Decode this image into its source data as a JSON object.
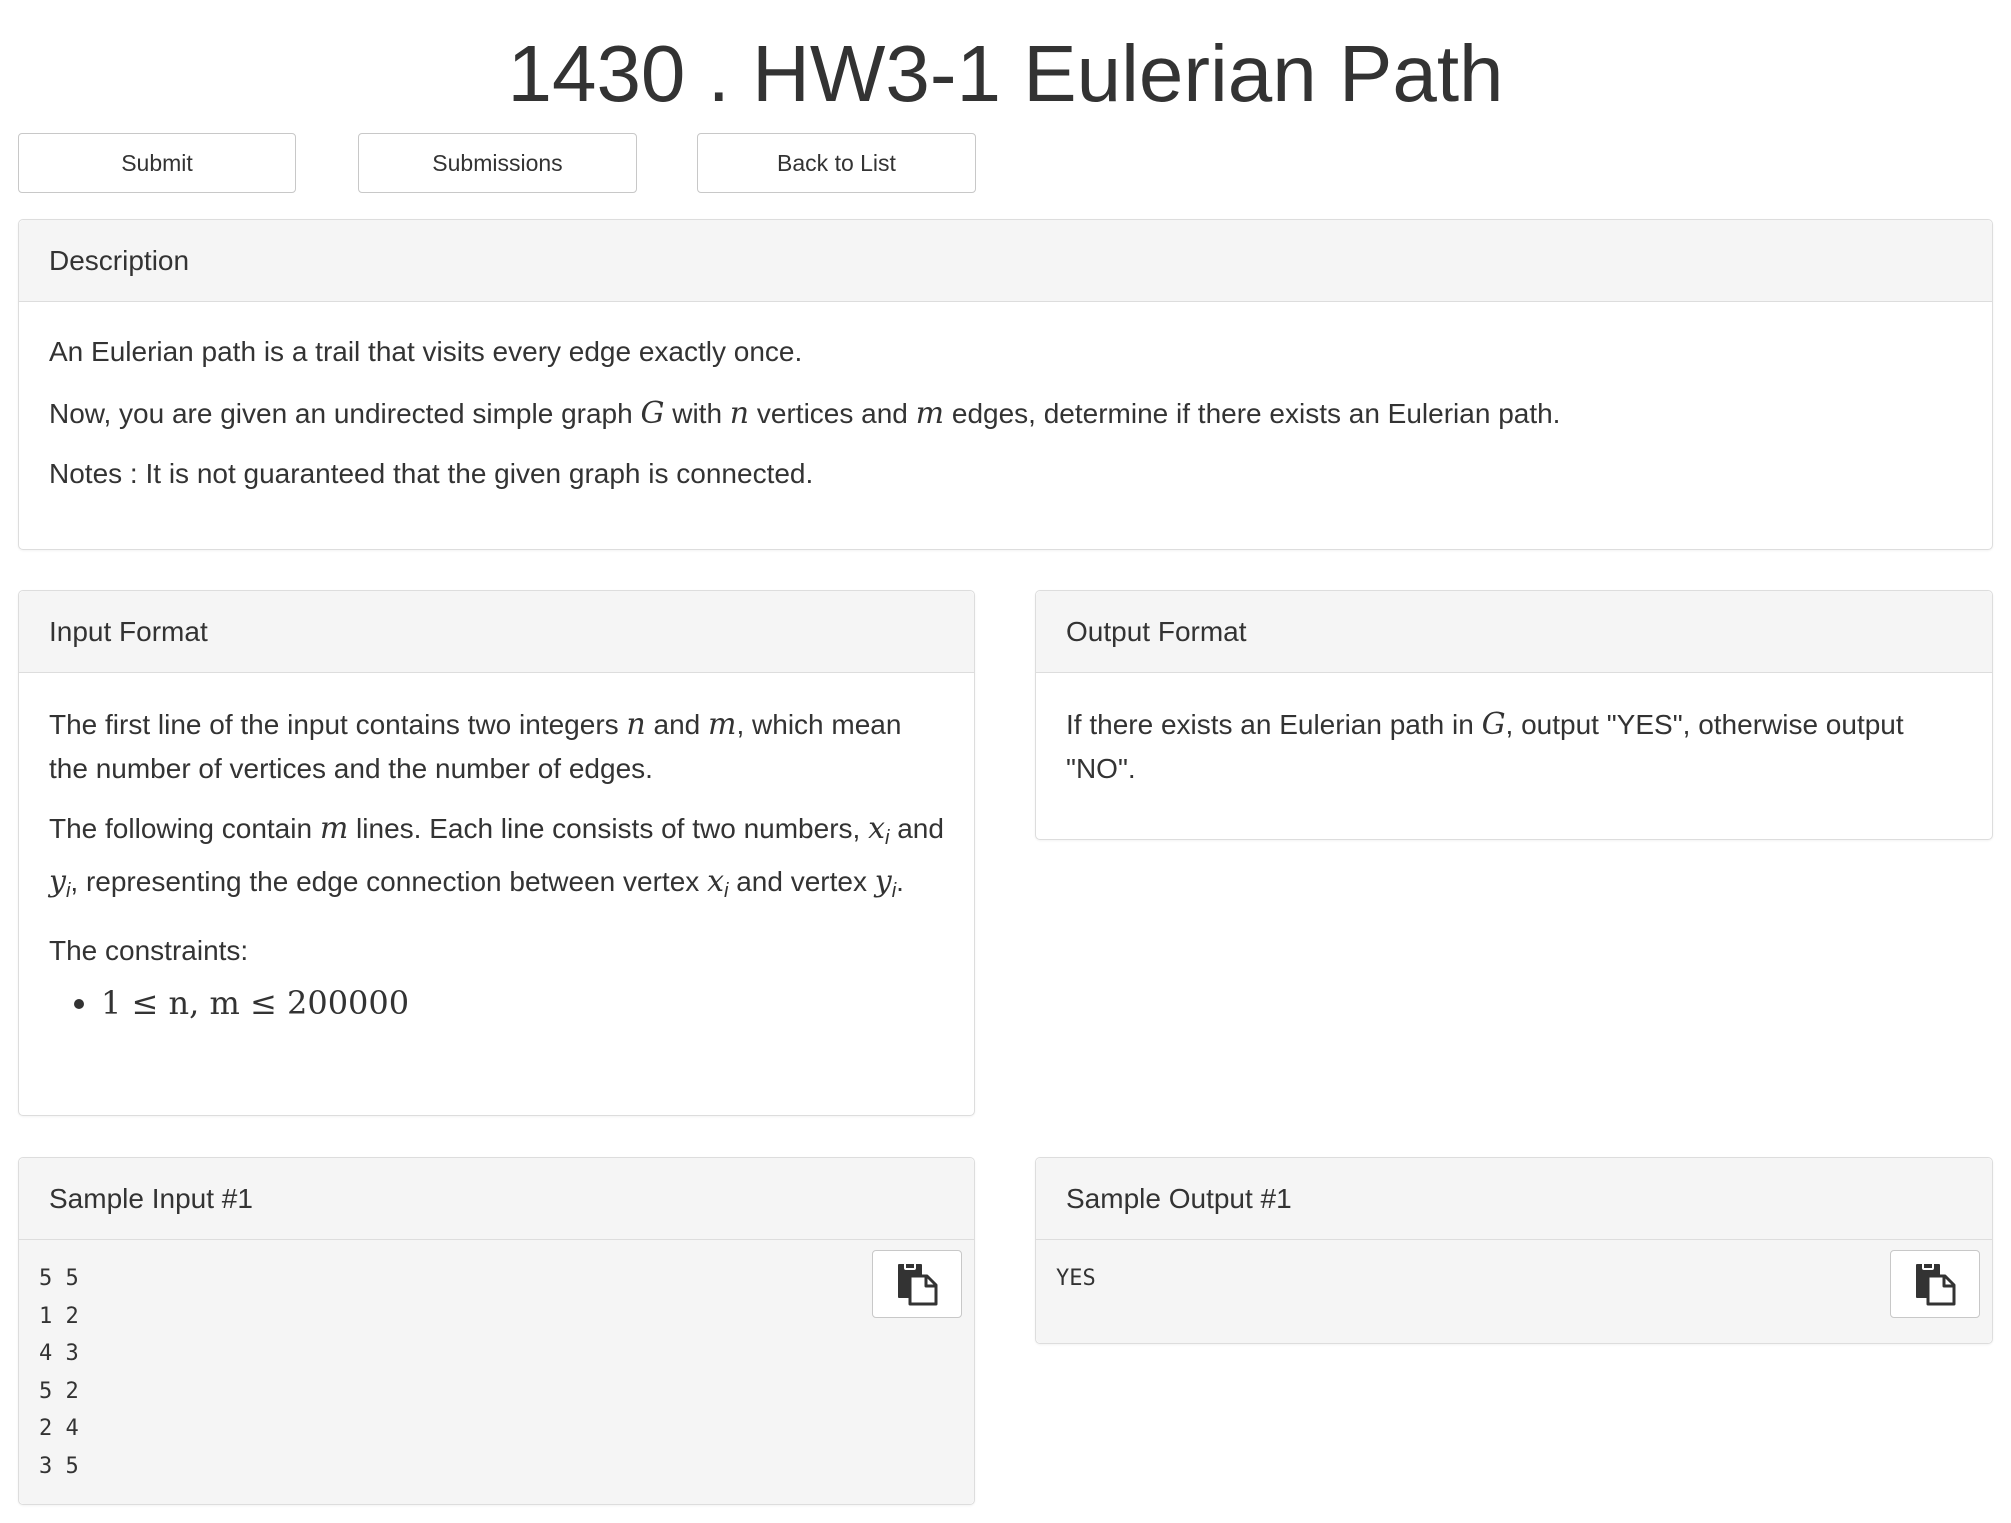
{
  "title": "1430 . HW3-1 Eulerian Path",
  "buttons": {
    "submit": "Submit",
    "submissions": "Submissions",
    "back": "Back to List"
  },
  "description": {
    "heading": "Description",
    "p1": "An Eulerian path is a trail that visits every edge exactly once.",
    "p2_a": "Now, you are given an undirected simple graph ",
    "p2_G": "G",
    "p2_b": " with ",
    "p2_n": "n",
    "p2_c": " vertices and ",
    "p2_m": "m",
    "p2_d": " edges, determine if there exists an Eulerian path.",
    "p3": "Notes : It is not guaranteed that the given graph is connected."
  },
  "input_format": {
    "heading": "Input Format",
    "p1_a": "The first line of the input contains two integers ",
    "p1_n": "n",
    "p1_b": " and ",
    "p1_m": "m",
    "p1_c": ", which mean the number of vertices and the number of edges.",
    "p2_a": "The following contain ",
    "p2_m": "m",
    "p2_b": " lines. Each line consists of two numbers, ",
    "p2_x": "x",
    "p2_i1": "i",
    "p2_c": " and ",
    "p2_y": "y",
    "p2_i2": "i",
    "p2_d": ", representing the edge connection between vertex ",
    "p2_x2": "x",
    "p2_i3": "i",
    "p2_e": " and vertex ",
    "p2_y2": "y",
    "p2_i4": "i",
    "p2_f": ".",
    "p3": "The constraints:",
    "constraint": "1 ≤ n, m ≤ 200000"
  },
  "output_format": {
    "heading": "Output Format",
    "p1_a": "If there exists an Eulerian path in ",
    "p1_G": "G",
    "p1_b": ", output \"YES\", otherwise output \"NO\"."
  },
  "sample_input": {
    "heading": "Sample Input #1",
    "code": "5 5\n1 2\n4 3\n5 2\n2 4\n3 5"
  },
  "sample_output": {
    "heading": "Sample Output #1",
    "code": "YES"
  },
  "icons": {
    "copy": "copy-icon"
  }
}
